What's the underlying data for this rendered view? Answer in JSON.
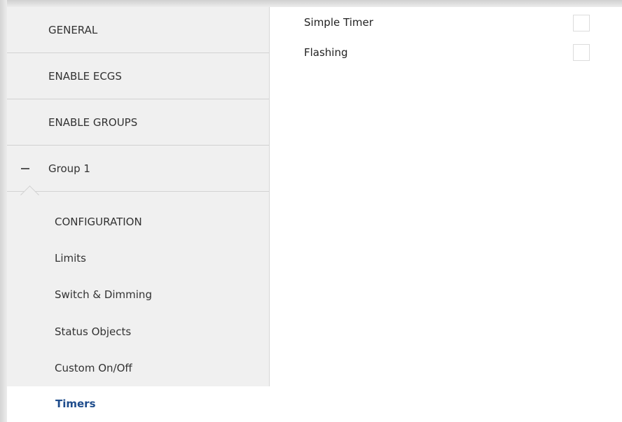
{
  "sidebar": {
    "top_items": [
      {
        "label": "GENERAL"
      },
      {
        "label": "ENABLE ECGS"
      },
      {
        "label": "ENABLE GROUPS"
      },
      {
        "label": "Group 1",
        "expanded": true,
        "icon": "minus-icon"
      }
    ],
    "sub_items": [
      {
        "label": "CONFIGURATION"
      },
      {
        "label": "Limits"
      },
      {
        "label": "Switch & Dimming"
      },
      {
        "label": "Status Objects"
      },
      {
        "label": "Custom On/Off"
      }
    ],
    "active_item": {
      "label": "Timers",
      "color": "#1e4c8c"
    }
  },
  "main": {
    "params": [
      {
        "label": "Simple Timer",
        "checked": false
      },
      {
        "label": "Flashing",
        "checked": false
      }
    ]
  }
}
